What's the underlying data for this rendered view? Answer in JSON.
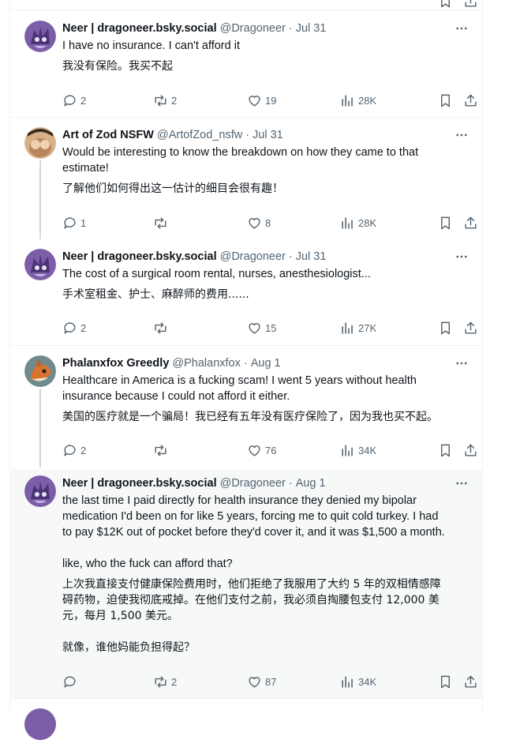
{
  "posts": [
    {
      "name": "Neer | dragoneer.bsky.social",
      "handle": "@Dragoneer",
      "date": "Jul 31",
      "paragraphs": [
        "I have no insurance. I can't afford it",
        "我没有保险。我买不起"
      ],
      "actions": {
        "reply": "2",
        "repost": "2",
        "like": "19",
        "views": "28K"
      }
    },
    {
      "name": "Art of Zod NSFW",
      "handle": "@ArtofZod_nsfw",
      "date": "Jul 31",
      "paragraphs": [
        "Would be interesting to know the breakdown on how they came to that\nestimate!",
        "了解他们如何得出这一估计的细目会很有趣！"
      ],
      "actions": {
        "reply": "1",
        "repost": "",
        "like": "8",
        "views": "28K"
      }
    },
    {
      "name": "Neer | dragoneer.bsky.social",
      "handle": "@Dragoneer",
      "date": "Jul 31",
      "paragraphs": [
        "The cost of a surgical room rental, nurses, anesthesiologist...",
        "手术室租金、护士、麻醉师的费用......"
      ],
      "actions": {
        "reply": "2",
        "repost": "",
        "like": "15",
        "views": "27K"
      }
    },
    {
      "name": "Phalanxfox Greedly",
      "handle": "@Phalanxfox",
      "date": "Aug 1",
      "paragraphs": [
        "Healthcare in America is a fucking scam! I went 5 years without health\ninsurance because I could not afford it either.",
        "美国的医疗就是一个骗局！我已经有五年没有医疗保险了，因为我也买不起。"
      ],
      "actions": {
        "reply": "2",
        "repost": "",
        "like": "76",
        "views": "34K"
      }
    },
    {
      "name": "Neer | dragoneer.bsky.social",
      "handle": "@Dragoneer",
      "date": "Aug 1",
      "paragraphs": [
        "the last time I paid directly for health insurance they denied my bipolar\nmedication I'd been on for like 5 years, forcing me to quit cold turkey. I had\nto pay $12K out of pocket before they'd cover it, and it was $1,500 a month.",
        "",
        "like, who the fuck can afford that?",
        "上次我直接支付健康保险费用时，他们拒绝了我服用了大约 5 年的双相情感障\n碍药物，迫使我彻底戒掉。在他们支付之前，我必须自掏腰包支付 12,000 美\n元，每月 1,500 美元。",
        "",
        "就像，谁他妈能负担得起？"
      ],
      "actions": {
        "reply": "",
        "repost": "2",
        "like": "87",
        "views": "34K"
      }
    }
  ],
  "colors": {
    "text": "#0f1419",
    "secondary": "#536471",
    "thread_line": "#cfd9de",
    "border": "#eff3f4",
    "highlight_bg": "#f7f9f9"
  },
  "icons": {
    "reply": "comment-icon",
    "repost": "repost-icon",
    "like": "heart-icon",
    "views": "analytics-icon",
    "bookmark": "bookmark-icon",
    "share": "share-icon",
    "more": "ellipsis-icon"
  }
}
